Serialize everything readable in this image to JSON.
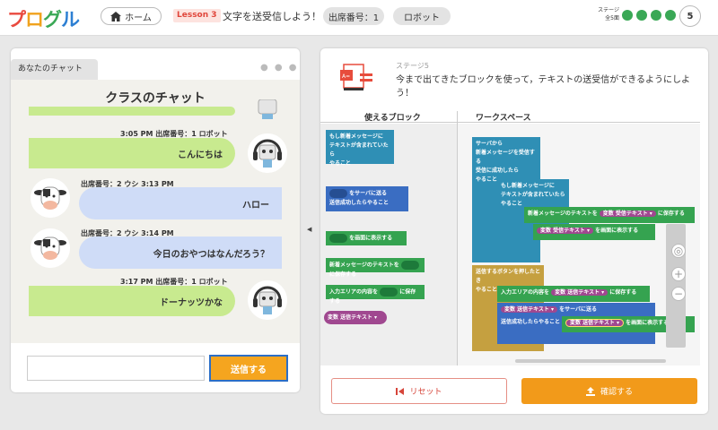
{
  "header": {
    "logo": "プログル",
    "home_label": "ホーム",
    "lesson_badge": "Lesson 3",
    "lesson_title": "文字を送受信しよう！",
    "seat_label": "出席番号：1",
    "robot_label": "ロボット",
    "stage_label_line1": "ステージ",
    "stage_label_line2": "全5面",
    "stage_number": "5",
    "progress_color": "#3aa856"
  },
  "chat": {
    "tab_label": "あなたのチャット",
    "title": "クラスのチャット",
    "messages": [
      {
        "meta": "3:05 PM  出席番号：1  ロボット",
        "text": "こんにちは",
        "side": "right"
      },
      {
        "meta": "出席番号：2  ウシ  3:13 PM",
        "text": "ハロー",
        "side": "left"
      },
      {
        "meta": "出席番号：2  ウシ  3:14 PM",
        "text": "今日のおやつはなんだろう？",
        "side": "left"
      },
      {
        "meta": "3:17 PM  出席番号：1  ロボット",
        "text": "ドーナッツかな",
        "side": "right"
      }
    ],
    "input_value": "",
    "send_label": "送信する"
  },
  "stage": {
    "label": "ステージ5",
    "description": "今まで出てきたブロックを使って，テキストの送受信ができるようにしよう！"
  },
  "palette": {
    "header": "使えるブロック",
    "blocks": {
      "if_new_msg_1": "もし新着メッセージに",
      "if_new_msg_2": "テキストが含まれていたら",
      "if_new_msg_3": "やること",
      "send_server_1": "をサーバに送る",
      "send_server_2": "送信成功したらやること",
      "show_screen": "を画面に表示する",
      "save_new_text_1": "新着メッセージのテキストを",
      "save_new_text_2": "に保存する",
      "save_input_1": "入力エリアの内容を",
      "save_input_2": "に保存する",
      "var_send_text": "変数  送信テキスト ▾"
    }
  },
  "workspace": {
    "header": "ワークスペース",
    "blocks": {
      "server_recv_1": "サーバから",
      "server_recv_2": "新着メッセージを受信する",
      "server_recv_3": "受信に成功したら",
      "server_recv_4": "やること",
      "if_new_1": "もし新着メッセージに",
      "if_new_2": "テキストが含まれていたら",
      "if_new_3": "やること",
      "save_new_text": "新着メッセージのテキストを",
      "var_recv_text": "変数  受信テキスト ▾",
      "save_to": "に保存する",
      "show_screen": "を画面に表示する",
      "send_btn_1": "送信するボタンを押したとき",
      "send_btn_2": "やること",
      "save_input": "入力エリアの内容を",
      "var_send_text": "変数  送信テキスト ▾",
      "send_server": "をサーバに送る",
      "send_success": "送信成功したらやること"
    }
  },
  "actions": {
    "reset_label": "リセット",
    "confirm_label": "確認する"
  }
}
